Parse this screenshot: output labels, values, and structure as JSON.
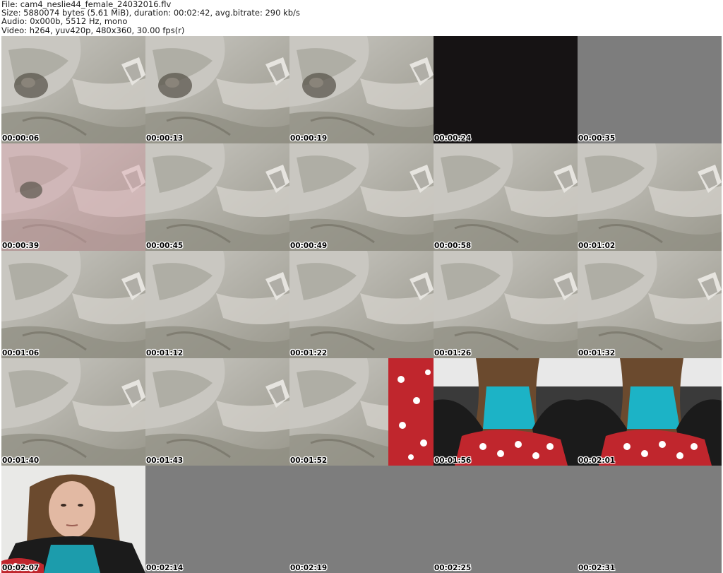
{
  "header": {
    "file_line": "File: cam4_neslie44_female_24032016.flv",
    "size_line": "Size: 5880074 bytes (5.61 MiB), duration: 00:02:42, avg.bitrate: 290 kb/s",
    "audio_line": "Audio: 0x000b, 5512 Hz, mono",
    "video_line": "Video: h264, yuv420p, 480x360, 30.00 fps(r)"
  },
  "thumbnails": [
    {
      "time": "00:00:06",
      "scene": "bedding-cat"
    },
    {
      "time": "00:00:13",
      "scene": "bedding-cat"
    },
    {
      "time": "00:00:19",
      "scene": "bedding-cat"
    },
    {
      "time": "00:00:24",
      "scene": "dark"
    },
    {
      "time": "00:00:35",
      "scene": "empty"
    },
    {
      "time": "00:00:39",
      "scene": "bedding-pink"
    },
    {
      "time": "00:00:45",
      "scene": "bedding"
    },
    {
      "time": "00:00:49",
      "scene": "bedding"
    },
    {
      "time": "00:00:58",
      "scene": "bedding"
    },
    {
      "time": "00:01:02",
      "scene": "bedding"
    },
    {
      "time": "00:01:06",
      "scene": "bedding"
    },
    {
      "time": "00:01:12",
      "scene": "bedding"
    },
    {
      "time": "00:01:22",
      "scene": "bedding"
    },
    {
      "time": "00:01:26",
      "scene": "bedding"
    },
    {
      "time": "00:01:32",
      "scene": "bedding"
    },
    {
      "time": "00:01:40",
      "scene": "bedding"
    },
    {
      "time": "00:01:43",
      "scene": "bedding"
    },
    {
      "time": "00:01:52",
      "scene": "bedding-red"
    },
    {
      "time": "00:01:56",
      "scene": "person-lap"
    },
    {
      "time": "00:02:01",
      "scene": "person-lap"
    },
    {
      "time": "00:02:07",
      "scene": "person-face"
    },
    {
      "time": "00:02:14",
      "scene": "empty"
    },
    {
      "time": "00:02:19",
      "scene": "empty"
    },
    {
      "time": "00:02:25",
      "scene": "empty"
    },
    {
      "time": "00:02:31",
      "scene": "empty"
    }
  ],
  "colors": {
    "empty": "#7d7d7d",
    "dark": "#161314",
    "bedding_base": "#b9b8b3",
    "bedding_shadow": "#8f8e82",
    "pink_tint": "#d9a4ae",
    "red_fabric": "#c0262d",
    "teal_top": "#1cb3c6",
    "hair": "#6b4a2e"
  }
}
